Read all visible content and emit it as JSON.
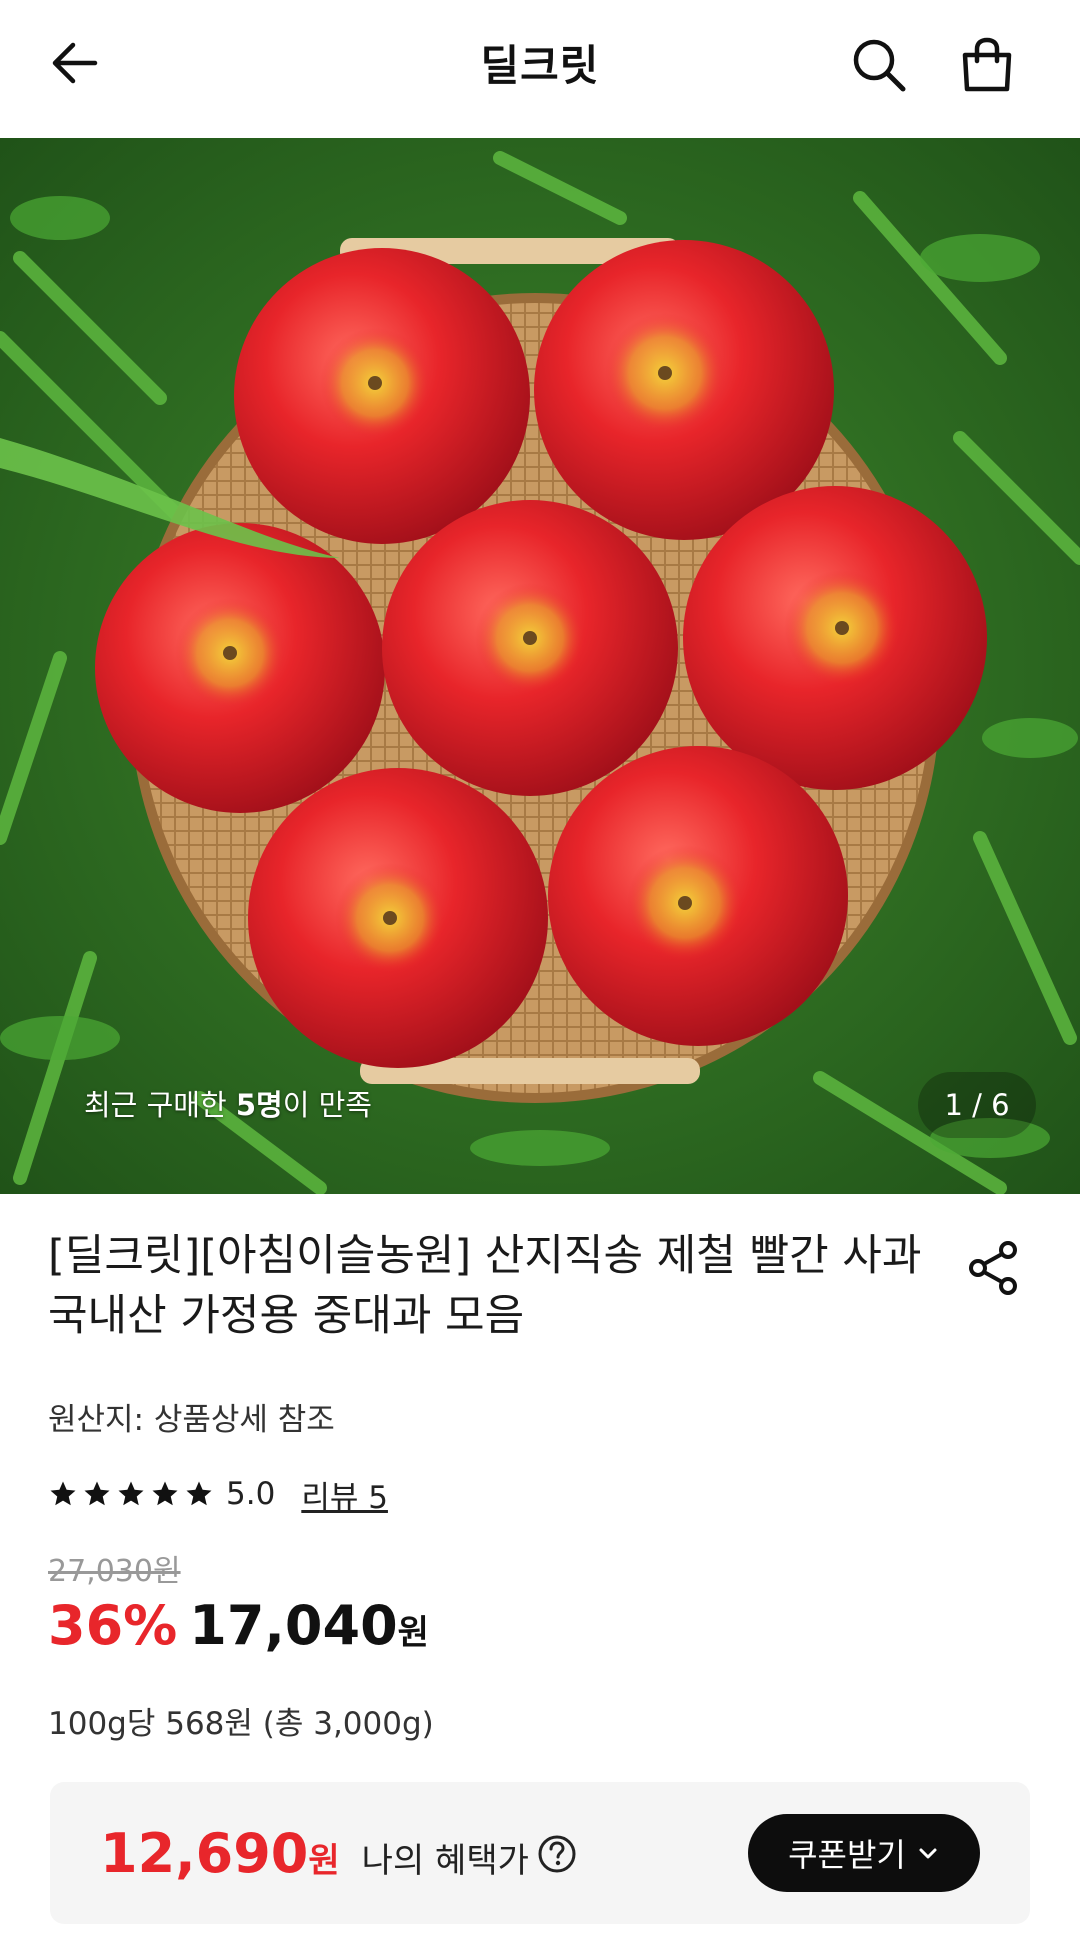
{
  "header": {
    "title": "딜크릿",
    "back_icon": "arrow-left-icon",
    "search_icon": "search-icon",
    "cart_icon": "shopping-bag-icon"
  },
  "hero": {
    "caption_prefix": "최근 구매한 ",
    "caption_bold": "5명",
    "caption_suffix": "이 만족",
    "counter": "1 / 6"
  },
  "product": {
    "title": "[딜크릿][아침이슬농원] 산지직송 제철 빨간 사과 국내산 가정용 중대과 모음",
    "origin": "원산지: 상품상세 참조",
    "rating": "5.0",
    "rating_stars": 5,
    "review_link": "리뷰 5",
    "original_price": "27,030원",
    "discount": "36%",
    "price": "17,040",
    "price_unit": "원",
    "per_unit": "100g당 568원 (총 3,000g)"
  },
  "benefit": {
    "amount": "12,690",
    "won": "원",
    "label": "나의 혜택가",
    "coupon_button": "쿠폰받기"
  },
  "colors": {
    "accent_red": "#e8262b",
    "dark_button": "#0d0d0d",
    "benefit_bg": "#f5f5f5"
  }
}
